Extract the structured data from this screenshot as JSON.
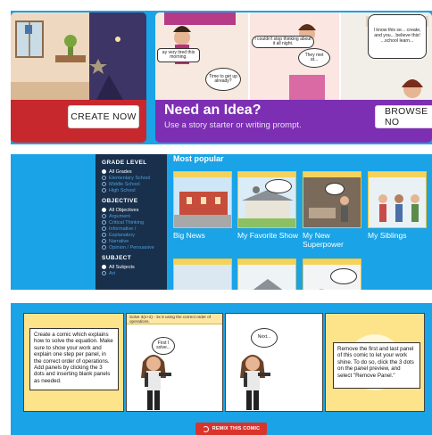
{
  "hero": {
    "create": {
      "button": "CREATE NOW"
    },
    "idea": {
      "title": "Need an Idea?",
      "subtitle": "Use a story starter or writing prompt.",
      "button": "BROWSE NO",
      "bubbles": [
        "Time to get up already?",
        "I couldn't stop thinking about it all night.",
        "They met at...",
        "I know this se... create, and you... believe this! ...school learn..."
      ],
      "caption": "ay very tired this morning."
    }
  },
  "browse": {
    "filters": [
      {
        "heading": "GRADE LEVEL",
        "options": [
          {
            "label": "All Grades",
            "on": true
          },
          {
            "label": "Elementary School",
            "on": false
          },
          {
            "label": "Middle School",
            "on": false
          },
          {
            "label": "High School",
            "on": false
          }
        ]
      },
      {
        "heading": "OBJECTIVE",
        "options": [
          {
            "label": "All Objectives",
            "on": true
          },
          {
            "label": "Argument",
            "on": false
          },
          {
            "label": "Critical Thinking",
            "on": false
          },
          {
            "label": "Informative /",
            "on": false
          },
          {
            "label": "Explanatory",
            "on": false
          },
          {
            "label": "Narrative",
            "on": false
          },
          {
            "label": "Opinion / Persuasive",
            "on": false
          }
        ]
      },
      {
        "heading": "SUBJECT",
        "options": [
          {
            "label": "All Subjects",
            "on": true
          },
          {
            "label": "Art",
            "on": false
          }
        ]
      }
    ],
    "section_title": "Most popular",
    "thumbs": [
      {
        "label": "Big News"
      },
      {
        "label": "My Favorite Show"
      },
      {
        "label": "My New Superpower"
      },
      {
        "label": "My Siblings"
      }
    ]
  },
  "storyboard": {
    "panel1_text": "Create a comic which explains how to solve the equation. Make sure to show your work and explain one step per panel, in the correct order of operations. Add panels by clicking the 3 dots and inserting blank panels as needed.",
    "panel2_caption": "Solve 3(x+2) - 3x 8 using the correct order of operations.",
    "panel2_bubble": "First I solve...",
    "panel3_bubble": "Next...",
    "panel4_text": "Remove the first and last panel of this comic to let your work shine. To do so, click the 3 dots on the panel preview, and select \"Remove Panel.\"",
    "remix_label": "REMIX THIS COMIC"
  }
}
